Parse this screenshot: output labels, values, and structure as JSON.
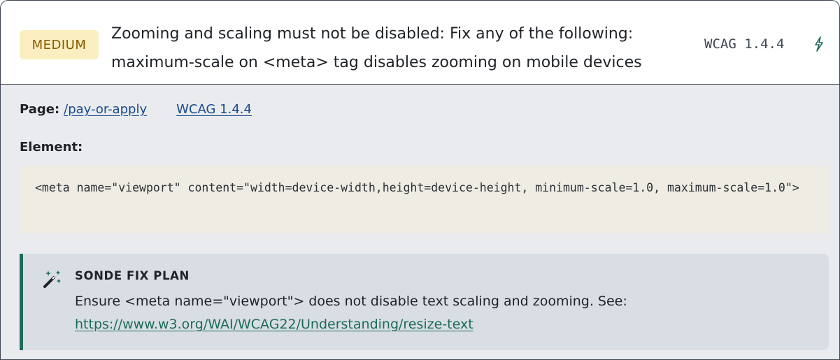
{
  "issue": {
    "severity": "MEDIUM",
    "title": "Zooming and scaling must not be disabled: Fix any of the following: maximum-scale on <meta> tag disables zooming on mobile devices",
    "wcag_code": "WCAG 1.4.4",
    "colors": {
      "badge_bg": "#fbeec0",
      "badge_text": "#8a5a00",
      "accent": "#1c6b5a",
      "link": "#1a4a8c"
    },
    "icons": {
      "header_action": "bolt-icon",
      "fix_plan": "magic-wand-icon"
    }
  },
  "details": {
    "page_label": "Page:",
    "page_link": "/pay-or-apply",
    "wcag_link": "WCAG 1.4.4",
    "element_label": "Element:",
    "element_code": "<meta name=\"viewport\" content=\"width=device-width,height=device-height, minimum-scale=1.0, maximum-scale=1.0\">"
  },
  "fix_plan": {
    "label": "SONDE FIX PLAN",
    "text": "Ensure <meta name=\"viewport\"> does not disable text scaling and zooming. See:",
    "link": "https://www.w3.org/WAI/WCAG22/Understanding/resize-text"
  }
}
